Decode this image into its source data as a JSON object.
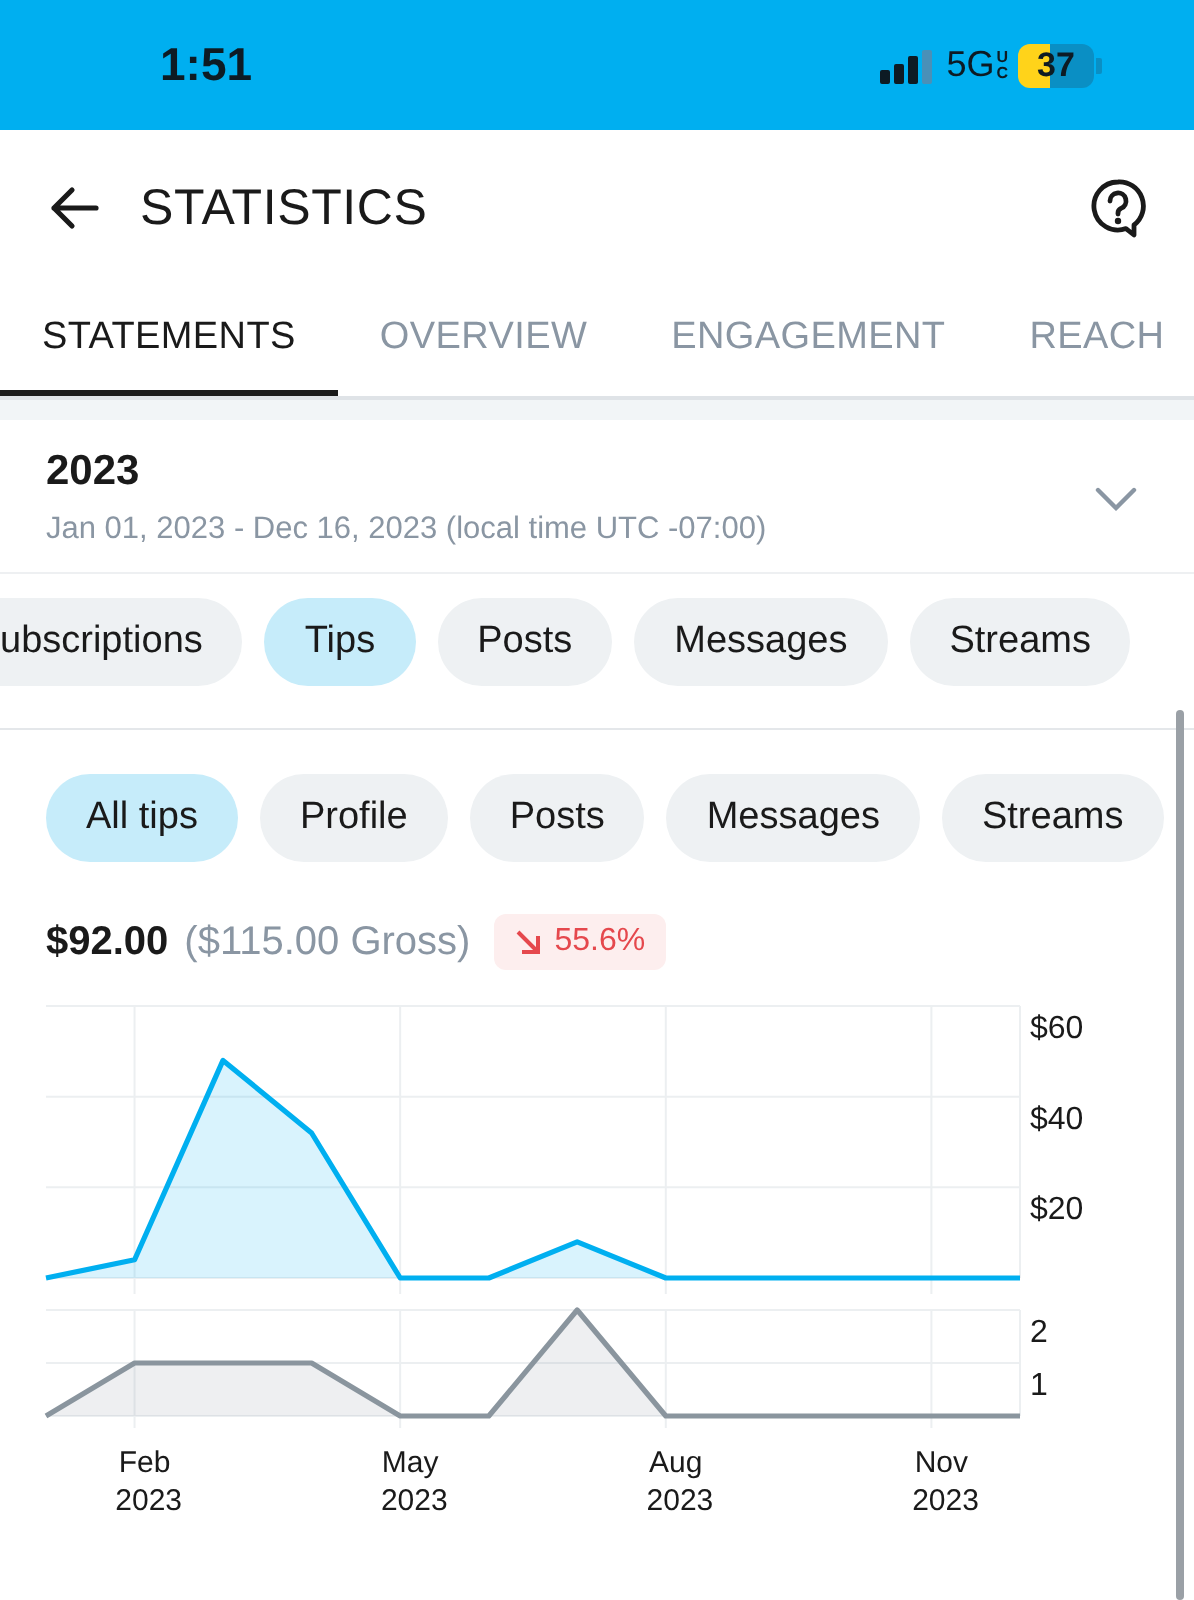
{
  "status_bar": {
    "time": "1:51",
    "network": "5G",
    "network_suffix": "UC",
    "battery": "37"
  },
  "header": {
    "title": "STATISTICS"
  },
  "tabs": [
    {
      "label": "STATEMENTS",
      "selected": true
    },
    {
      "label": "OVERVIEW",
      "selected": false
    },
    {
      "label": "ENGAGEMENT",
      "selected": false
    },
    {
      "label": "REACH",
      "selected": false
    }
  ],
  "period": {
    "title": "2023",
    "range": "Jan 01, 2023 - Dec 16, 2023 (local time UTC -07:00)"
  },
  "categories": [
    {
      "label": "ubscriptions",
      "selected": false,
      "cut_left": true
    },
    {
      "label": "Tips",
      "selected": true,
      "cut_left": false
    },
    {
      "label": "Posts",
      "selected": false,
      "cut_left": false
    },
    {
      "label": "Messages",
      "selected": false,
      "cut_left": false
    },
    {
      "label": "Streams",
      "selected": false,
      "cut_left": false
    }
  ],
  "filters": [
    {
      "label": "All tips",
      "selected": true
    },
    {
      "label": "Profile",
      "selected": false
    },
    {
      "label": "Posts",
      "selected": false
    },
    {
      "label": "Messages",
      "selected": false
    },
    {
      "label": "Streams",
      "selected": false
    }
  ],
  "summary": {
    "net": "$92.00",
    "gross": "($115.00 Gross)",
    "change": "55.6%"
  },
  "charts": [
    {
      "chart_data": {
        "type": "area",
        "grid": true,
        "series": [
          {
            "color": "#00aff0",
            "values": [
              0,
              4,
              48,
              32,
              0,
              0,
              8,
              0,
              0,
              0,
              0,
              0
            ]
          }
        ],
        "ylim": [
          0,
          60
        ],
        "yticks": [
          {
            "value": 20,
            "label": "$20"
          },
          {
            "value": 40,
            "label": "$40"
          },
          {
            "value": 60,
            "label": "$60"
          }
        ]
      }
    },
    {
      "chart_data": {
        "type": "area",
        "grid": true,
        "categories": [
          null,
          "Feb 2023",
          null,
          null,
          "May 2023",
          null,
          null,
          "Aug 2023",
          null,
          null,
          "Nov 2023",
          null
        ],
        "series": [
          {
            "color": "#8a959e",
            "values": [
              0,
              1,
              1,
              1,
              0,
              0,
              2,
              0,
              0,
              0,
              0,
              0
            ]
          }
        ],
        "ylim": [
          0,
          2
        ],
        "yticks": [
          1,
          2
        ]
      }
    }
  ]
}
